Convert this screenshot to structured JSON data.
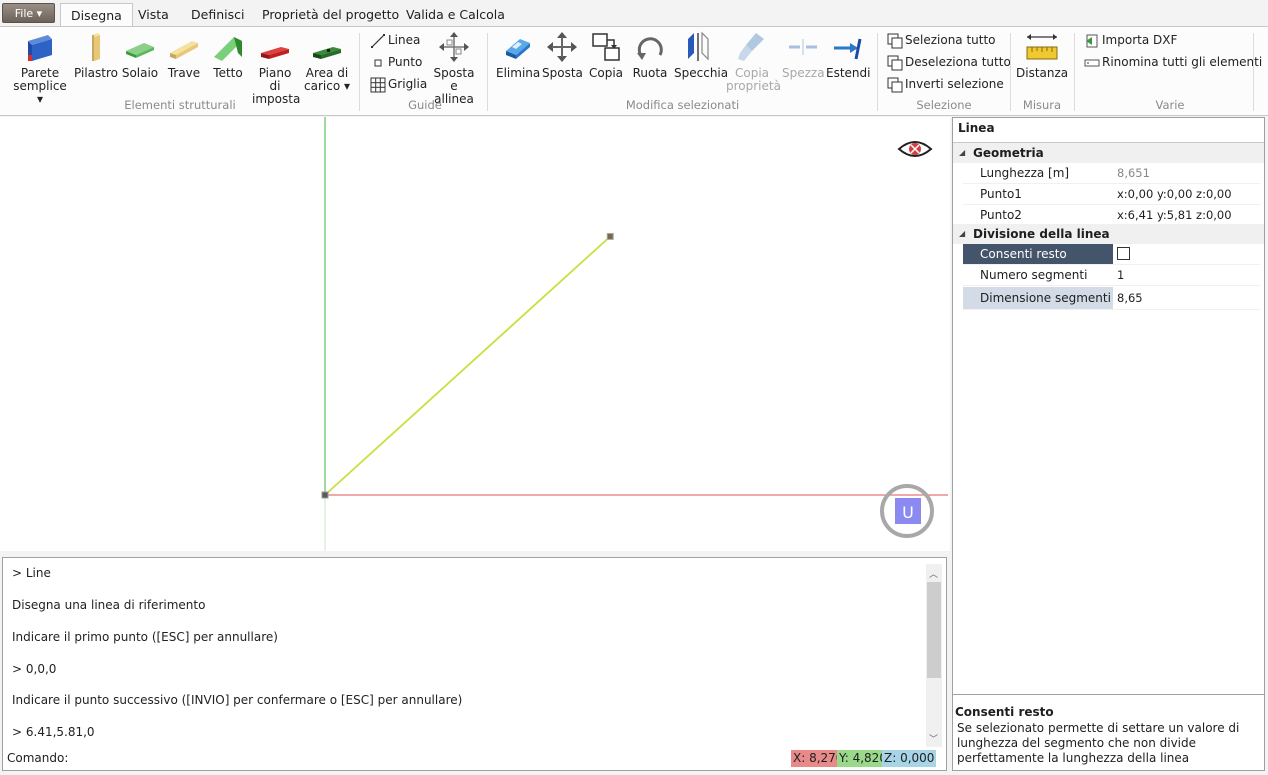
{
  "tabs": {
    "file": "File ▾",
    "items": [
      "Disegna",
      "Vista",
      "Definisci",
      "Proprietà del progetto",
      "Valida e Calcola"
    ]
  },
  "ribbon": {
    "structural": {
      "label": "Elementi strutturali",
      "parete": [
        "Parete",
        "semplice ▾"
      ],
      "pilastro": "Pilastro",
      "solaio": "Solaio",
      "trave": "Trave",
      "tetto": "Tetto",
      "piano": [
        "Piano di",
        "imposta"
      ],
      "area": [
        "Area di",
        "carico ▾"
      ]
    },
    "guides": {
      "label": "Guide",
      "linea": "Linea",
      "punto": "Punto",
      "griglia": "Griglia",
      "sposta": [
        "Sposta e",
        "allinea"
      ]
    },
    "modify": {
      "label": "Modifica selezionati",
      "elimina": "Elimina",
      "sposta": "Sposta",
      "copia": "Copia",
      "ruota": "Ruota",
      "specchia": "Specchia",
      "copia_prop": [
        "Copia",
        "proprietà"
      ],
      "spezza": "Spezza",
      "estendi": "Estendi"
    },
    "selection": {
      "label": "Selezione",
      "all": "Seleziona tutto",
      "none": "Deseleziona tutto",
      "invert": "Inverti selezione"
    },
    "measure": {
      "label": "Misura",
      "distanza": "Distanza"
    },
    "misc": {
      "label": "Varie",
      "import": "Importa DXF",
      "rename": "Rinomina tutti gli elementi"
    }
  },
  "viewport": {
    "line_start": {
      "x": 0,
      "y": 0
    },
    "line_end": {
      "x": 6.41,
      "y": 5.81
    },
    "ucs_label": "U"
  },
  "console": {
    "lines": [
      "> Line",
      "Disegna una linea di riferimento",
      "Indicare il primo punto ([ESC] per annullare)",
      "> 0,0,0",
      "Indicare il punto successivo ([INVIO] per confermare o [ESC] per annullare)",
      "> 6.41,5.81,0"
    ],
    "command_label": "Comando:",
    "coord_x": "X: 8,270",
    "coord_y": "Y: 4,820",
    "coord_z": "Z: 0,000"
  },
  "properties": {
    "title": "Linea",
    "geometry": {
      "label": "Geometria",
      "rows": [
        {
          "name": "Lunghezza [m]",
          "value": "8,651"
        },
        {
          "name": "Punto1",
          "value": "x:0,00 y:0,00 z:0,00"
        },
        {
          "name": "Punto2",
          "value": "x:6,41 y:5,81 z:0,00"
        }
      ]
    },
    "division": {
      "label": "Divisione della linea",
      "consenti_resto": "Consenti resto",
      "consenti_checked": false,
      "numero_segmenti": "Numero segmenti",
      "numero_value": "1",
      "dimensione_segmenti": "Dimensione segmenti",
      "dimensione_value": "8,65"
    },
    "description": {
      "title": "Consenti resto",
      "text": "Se selezionato permette di settare un valore di lunghezza del segmento che non divide perfettamente la lunghezza della linea"
    }
  },
  "colors": {
    "x_axis": "#e05050",
    "y_axis": "#3cb43c",
    "line": "#c8e040",
    "selected_row": "#44546a",
    "coord_x_bg": "#e88a8a",
    "coord_y_bg": "#9ad88a",
    "coord_z_bg": "#a8d4e8"
  }
}
